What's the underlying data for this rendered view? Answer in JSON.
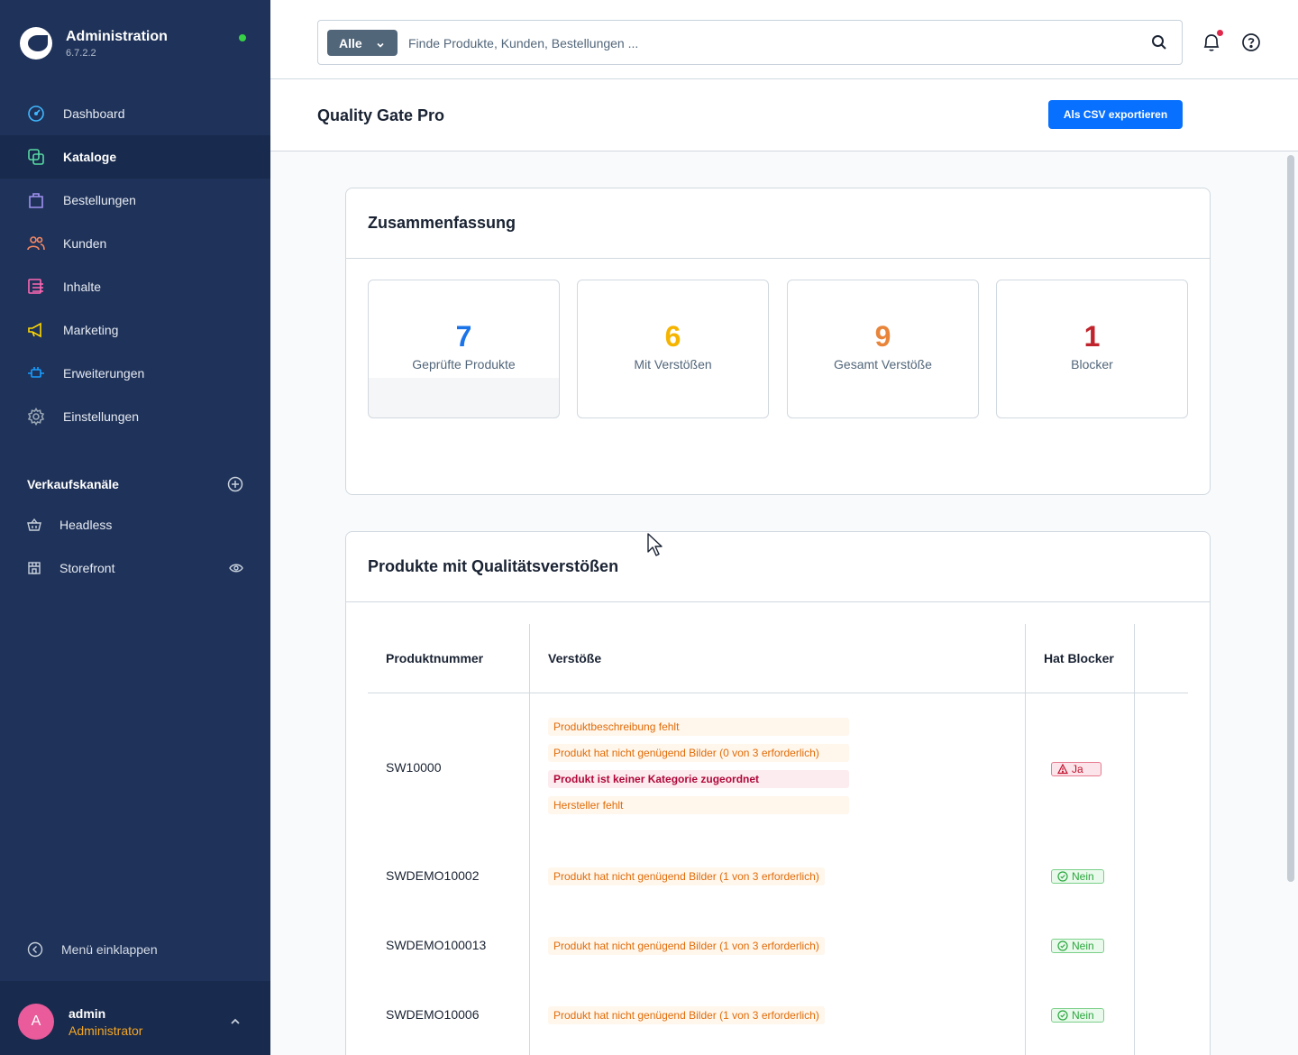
{
  "brand": {
    "title": "Administration",
    "version": "6.7.2.2"
  },
  "nav": [
    {
      "label": "Dashboard",
      "icon": "gauge-icon",
      "color": "#3fb7ff"
    },
    {
      "label": "Kataloge",
      "icon": "catalog-icon",
      "color": "#57d9a3"
    },
    {
      "label": "Bestellungen",
      "icon": "shopping-bag-icon",
      "color": "#a092f0"
    },
    {
      "label": "Kunden",
      "icon": "users-icon",
      "color": "#f88962"
    },
    {
      "label": "Inhalte",
      "icon": "content-icon",
      "color": "#ff68b4"
    },
    {
      "label": "Marketing",
      "icon": "megaphone-icon",
      "color": "#ffd700"
    },
    {
      "label": "Erweiterungen",
      "icon": "plug-icon",
      "color": "#189eff"
    },
    {
      "label": "Einstellungen",
      "icon": "gear-icon",
      "color": "#9aa8b5"
    }
  ],
  "sales_channels": {
    "title": "Verkaufskanäle",
    "items": [
      {
        "label": "Headless",
        "icon": "basket-icon"
      },
      {
        "label": "Storefront",
        "icon": "storefront-icon"
      }
    ]
  },
  "collapse_label": "Menü einklappen",
  "user": {
    "initial": "A",
    "name": "admin",
    "role": "Administrator"
  },
  "search": {
    "type_label": "Alle",
    "placeholder": "Finde Produkte, Kunden, Bestellungen ..."
  },
  "page": {
    "title": "Quality Gate Pro",
    "export_button": "Als CSV exportieren"
  },
  "summary": {
    "title": "Zusammenfassung",
    "kpis": [
      {
        "value": "7",
        "label": "Geprüfte Produkte",
        "color": "#1a73e8"
      },
      {
        "value": "6",
        "label": "Mit Verstößen",
        "color": "#f5b400"
      },
      {
        "value": "9",
        "label": "Gesamt Verstöße",
        "color": "#e8853a"
      },
      {
        "value": "1",
        "label": "Blocker",
        "color": "#c0232c"
      }
    ]
  },
  "products": {
    "title": "Produkte mit Qualitätsverstößen",
    "columns": [
      "Produktnummer",
      "Verstöße",
      "Hat Blocker"
    ],
    "rows": [
      {
        "number": "SW10000",
        "violations": [
          "Produktbeschreibung fehlt",
          "Produkt hat nicht genügend Bilder (0 von 3 erforderlich)",
          "Produkt ist keiner Kategorie zugeordnet",
          "Hersteller fehlt"
        ],
        "blocker": "Ja"
      },
      {
        "number": "SWDEMO10002",
        "violations": [
          "Produkt hat nicht genügend Bilder (1 von 3 erforderlich)"
        ],
        "blocker": "Nein"
      },
      {
        "number": "SWDEMO100013",
        "violations": [
          "Produkt hat nicht genügend Bilder (1 von 3 erforderlich)"
        ],
        "blocker": "Nein"
      },
      {
        "number": "SWDEMO10006",
        "violations": [
          "Produkt hat nicht genügend Bilder (1 von 3 erforderlich)"
        ],
        "blocker": "Nein"
      }
    ]
  }
}
